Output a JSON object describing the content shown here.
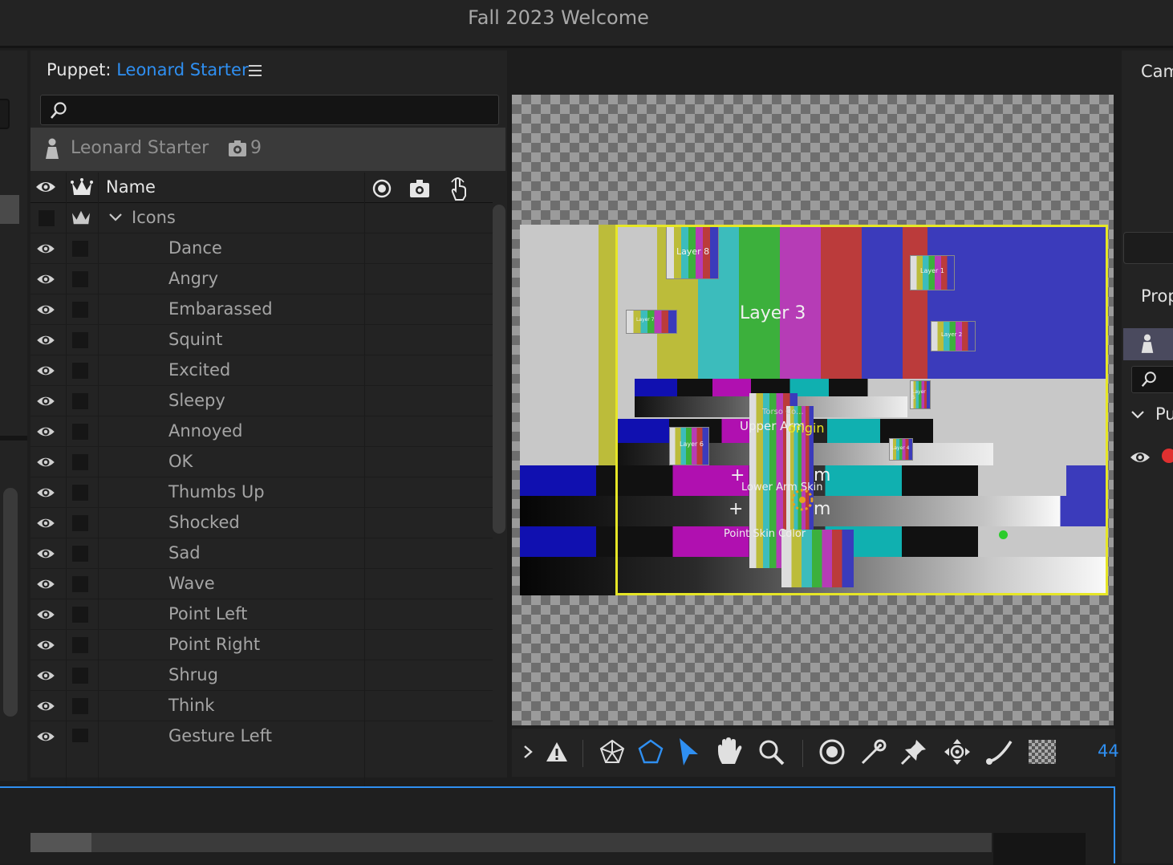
{
  "window": {
    "title": "Fall 2023 Welcome"
  },
  "puppet_panel": {
    "label_prefix": "Puppet:",
    "puppet_name": "Leonard Starter",
    "search_placeholder": "",
    "puppet_row": {
      "name": "Leonard Starter",
      "count": "9"
    },
    "columns": {
      "name": "Name"
    },
    "group": {
      "name": "Icons"
    },
    "items": [
      "Dance",
      "Angry",
      "Embarassed",
      "Squint",
      "Excited",
      "Sleepy",
      "Annoyed",
      "OK",
      "Thumbs Up",
      "Shocked",
      "Sad",
      "Wave",
      "Point Left",
      "Point Right",
      "Shrug",
      "Think",
      "Gesture Left"
    ]
  },
  "scene": {
    "labels": {
      "layer3": "Layer 3",
      "layer8": "Layer 8",
      "layer1": "Layer 1",
      "layer2": "Layer 2",
      "layer6": "Layer 6",
      "layer7": "Layer 7",
      "layer4": "Layer 4",
      "layer5": "Layer 5",
      "torso": "Torso Co...",
      "upper_arm": "Upper Arm",
      "lower_arm_skin": "Lower Arm Skin",
      "skin_color": "Point Skin Color",
      "origin": "origin",
      "m1": "+",
      "m2": "m",
      "m3": "+",
      "m4": "m"
    },
    "colors": {
      "selection": "#e6e626",
      "white": "#c8c8c8",
      "yellow": "#bcbc3a",
      "cyan": "#3cbcbc",
      "green": "#3cb03c",
      "magenta": "#b63cb6",
      "red": "#bb3b3b",
      "blue": "#3b3bbb"
    }
  },
  "toolbar": {
    "zoom": "44",
    "tools": [
      "chevron-right",
      "warning",
      "mesh",
      "polygon",
      "select-arrow",
      "hand",
      "zoom",
      "origin",
      "dragger",
      "pin",
      "transform",
      "stick",
      "checker"
    ]
  },
  "right_panel": {
    "camera_label": "Cam",
    "properties_label": "Prop",
    "puppet_label": "Pu"
  }
}
